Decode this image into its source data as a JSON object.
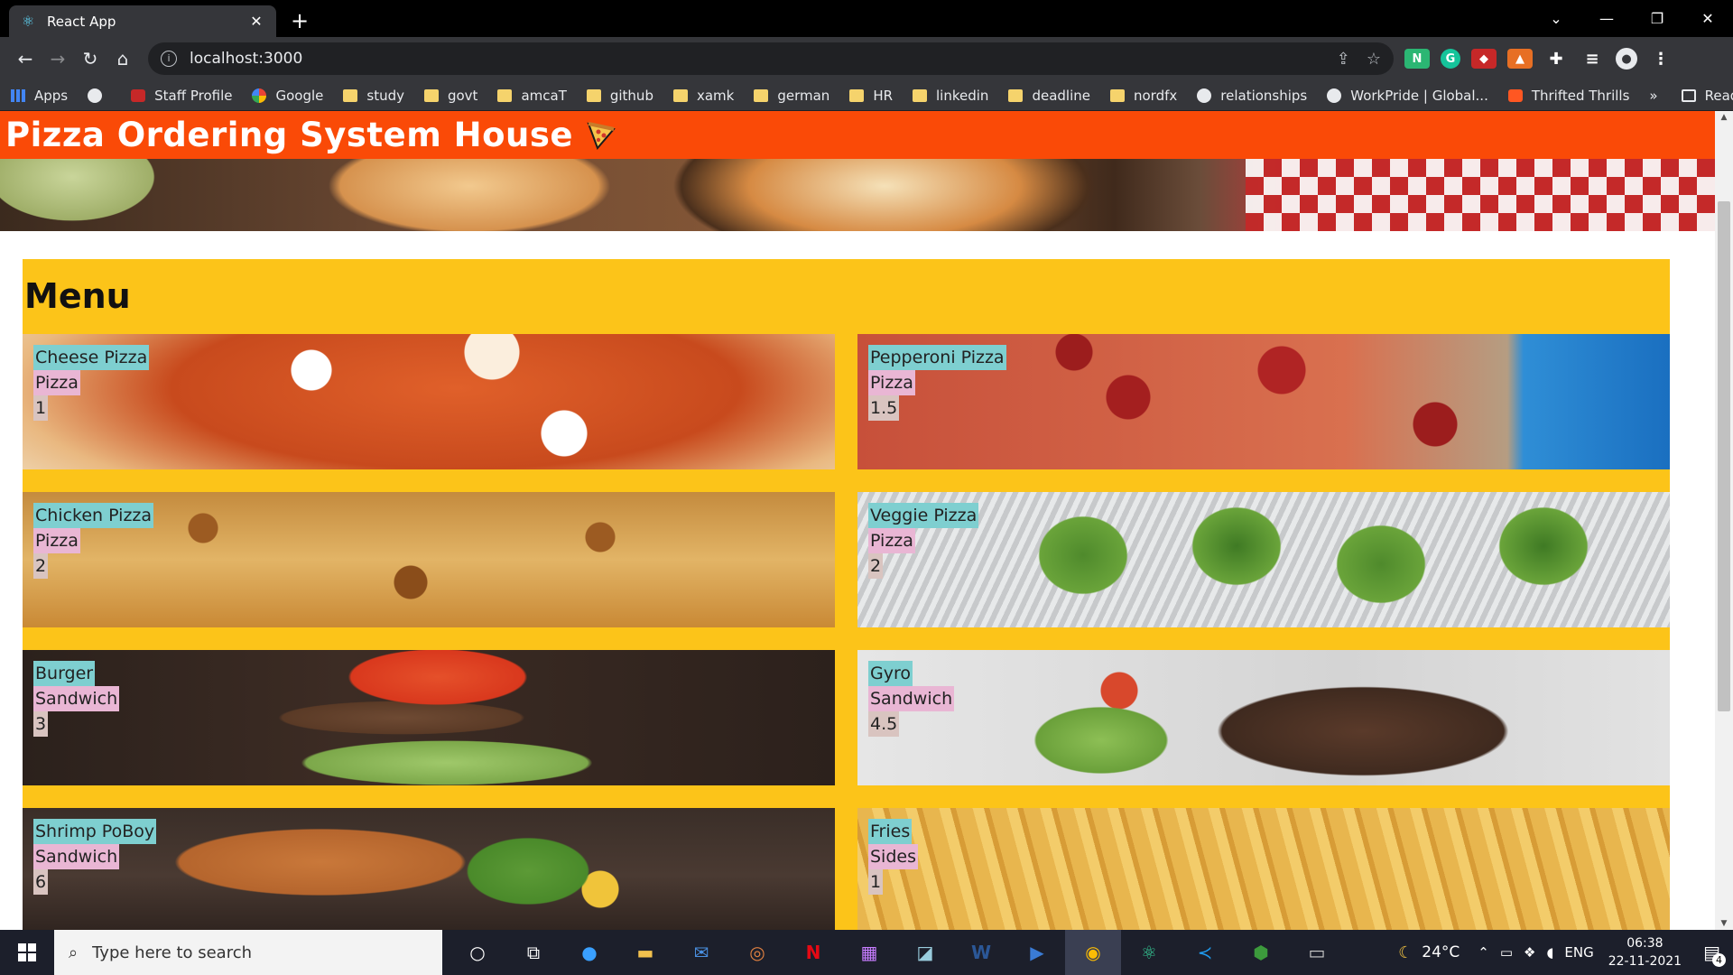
{
  "browser": {
    "tab_title": "React App",
    "url": "localhost:3000",
    "bookmarks": [
      {
        "label": "Apps",
        "icon": "apps-grid-icon"
      },
      {
        "label": "",
        "icon": "globe-icon"
      },
      {
        "label": "Staff Profile",
        "icon": "profile-icon"
      },
      {
        "label": "Google",
        "icon": "google-icon"
      },
      {
        "label": "study",
        "icon": "folder-icon"
      },
      {
        "label": "govt",
        "icon": "folder-icon"
      },
      {
        "label": "amcaT",
        "icon": "folder-icon"
      },
      {
        "label": "github",
        "icon": "folder-icon"
      },
      {
        "label": "xamk",
        "icon": "folder-icon"
      },
      {
        "label": "german",
        "icon": "folder-icon"
      },
      {
        "label": "HR",
        "icon": "folder-icon"
      },
      {
        "label": "linkedin",
        "icon": "folder-icon"
      },
      {
        "label": "deadline",
        "icon": "folder-icon"
      },
      {
        "label": "nordfx",
        "icon": "folder-icon"
      },
      {
        "label": "relationships",
        "icon": "site-icon"
      },
      {
        "label": "WorkPride | Global...",
        "icon": "site-icon"
      },
      {
        "label": "Thrifted Thrills",
        "icon": "blogger-icon"
      }
    ],
    "bookmarks_more": "»",
    "reading_list": "Reading list"
  },
  "app": {
    "title": "Pizza Ordering System House",
    "menu_title": "Menu",
    "items": [
      {
        "name": "Cheese Pizza",
        "category": "Pizza",
        "price": "1",
        "img": "img-cheese"
      },
      {
        "name": "Pepperoni Pizza",
        "category": "Pizza",
        "price": "1.5",
        "img": "img-pepperoni"
      },
      {
        "name": "Chicken Pizza",
        "category": "Pizza",
        "price": "2",
        "img": "img-chicken"
      },
      {
        "name": "Veggie Pizza",
        "category": "Pizza",
        "price": "2",
        "img": "img-veggie"
      },
      {
        "name": "Burger",
        "category": "Sandwich",
        "price": "3",
        "img": "img-burger"
      },
      {
        "name": "Gyro",
        "category": "Sandwich",
        "price": "4.5",
        "img": "img-gyro"
      },
      {
        "name": "Shrimp PoBoy",
        "category": "Sandwich",
        "price": "6",
        "img": "img-shrimp"
      },
      {
        "name": "Fries",
        "category": "Sides",
        "price": "1",
        "img": "img-fries"
      }
    ]
  },
  "taskbar": {
    "search_placeholder": "Type here to search",
    "weather": "24°C",
    "language": "ENG",
    "time": "06:38",
    "date": "22-11-2021",
    "notification_count": "4"
  },
  "colors": {
    "header": "#fa4a07",
    "menu_bg": "#fcc419",
    "name_bg": "#7ecfd0",
    "category_bg": "#e9b6d4",
    "price_bg": "#d9c4c0"
  }
}
